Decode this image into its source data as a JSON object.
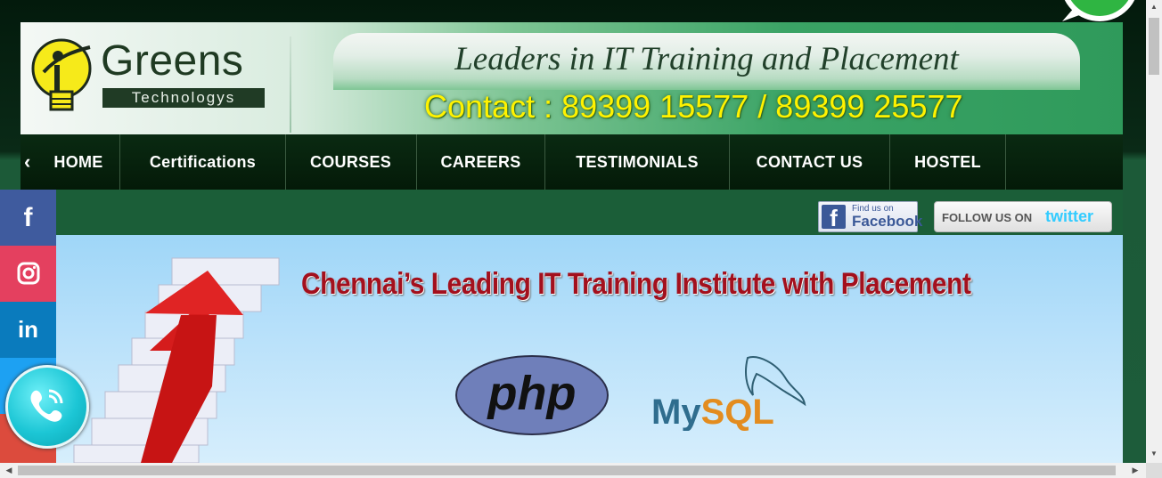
{
  "header": {
    "logo_brand": "Greens",
    "logo_tagline": "Technologys",
    "tagline": "Leaders in IT Training and Placement",
    "contact": "Contact : 89399 15577 / 89399 25577"
  },
  "nav": {
    "items": [
      "HOME",
      "Certifications",
      "COURSES",
      "CAREERS",
      "TESTIMONIALS",
      "CONTACT US",
      "HOSTEL"
    ]
  },
  "social": {
    "facebook_small": "Find us on",
    "facebook_big": "Facebook",
    "twitter_follow": "FOLLOW US ON",
    "twitter_brand": "twitter"
  },
  "banner": {
    "headline": "Chennai’s Leading IT Training Institute with Placement",
    "logo1": "php",
    "logo2_part1": "My",
    "logo2_part2": "SQL"
  },
  "rail": {
    "facebook": "f",
    "linkedin": "in"
  },
  "colors": {
    "nav_bg": "#041a08",
    "headline": "#a3101d",
    "contact": "#fff200",
    "banner_sky": "#9fd6f8"
  }
}
